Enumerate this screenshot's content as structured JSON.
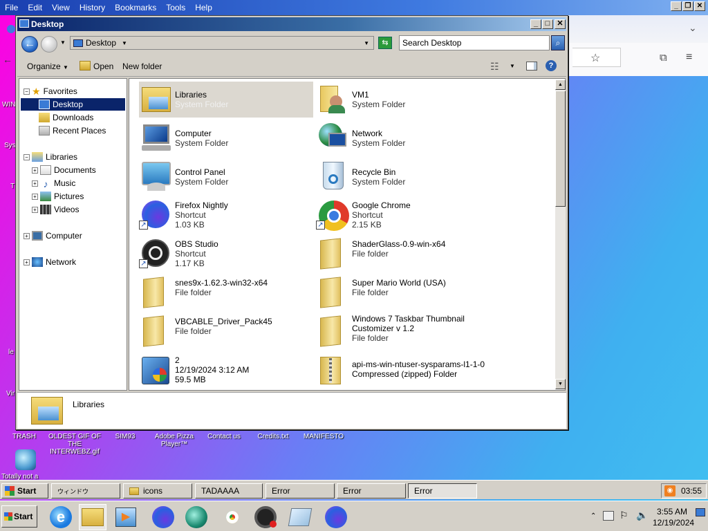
{
  "menubar": {
    "items": [
      "File",
      "Edit",
      "View",
      "History",
      "Bookmarks",
      "Tools",
      "Help"
    ]
  },
  "desktop": {
    "icons": [
      "TRASH",
      "OLDEST GIF OF THE INTERWEBZ.gif",
      "SIM93",
      "Adobe Pizza Player™",
      "Contact us",
      "Credits.txt",
      "MANIFESTO"
    ],
    "shortcut_label": "Totally not a",
    "edge_labels": [
      "WIN",
      "Sys",
      "T",
      "le",
      "Vir"
    ]
  },
  "window": {
    "title": "Desktop",
    "address": "Desktop",
    "search_placeholder": "Search Desktop",
    "toolbar": {
      "organize": "Organize",
      "open": "Open",
      "new_folder": "New folder"
    }
  },
  "nav": {
    "favorites": "Favorites",
    "fav_items": [
      "Desktop",
      "Downloads",
      "Recent Places"
    ],
    "libraries": "Libraries",
    "lib_items": [
      "Documents",
      "Music",
      "Pictures",
      "Videos"
    ],
    "computer": "Computer",
    "network": "Network"
  },
  "items": [
    {
      "name": "Libraries",
      "l1": "System Folder",
      "l2": ""
    },
    {
      "name": "VM1",
      "l1": "System Folder",
      "l2": ""
    },
    {
      "name": "Computer",
      "l1": "System Folder",
      "l2": ""
    },
    {
      "name": "Network",
      "l1": "System Folder",
      "l2": ""
    },
    {
      "name": "Control Panel",
      "l1": "System Folder",
      "l2": ""
    },
    {
      "name": "Recycle Bin",
      "l1": "System Folder",
      "l2": ""
    },
    {
      "name": "Firefox Nightly",
      "l1": "Shortcut",
      "l2": "1.03 KB"
    },
    {
      "name": "Google Chrome",
      "l1": "Shortcut",
      "l2": "2.15 KB"
    },
    {
      "name": "OBS Studio",
      "l1": "Shortcut",
      "l2": "1.17 KB"
    },
    {
      "name": "ShaderGlass-0.9-win-x64",
      "l1": "File folder",
      "l2": ""
    },
    {
      "name": "snes9x-1.62.3-win32-x64",
      "l1": "File folder",
      "l2": ""
    },
    {
      "name": "Super Mario World (USA)",
      "l1": "File folder",
      "l2": ""
    },
    {
      "name": "VBCABLE_Driver_Pack45",
      "l1": "File folder",
      "l2": ""
    },
    {
      "name": "Windows 7 Taskbar Thumbnail",
      "l1": "Customizer v 1.2",
      "l2": "File folder"
    },
    {
      "name": "2",
      "l1": "12/19/2024 3:12 AM",
      "l2": "59.5 MB"
    },
    {
      "name": "api-ms-win-ntuser-sysparams-l1-1-0",
      "l1": "Compressed (zipped) Folder",
      "l2": ""
    }
  ],
  "details": {
    "name": "Libraries"
  },
  "taskbar1": {
    "start": "Start",
    "buttons": [
      "ウィンドウ",
      "icons",
      "TADAAAA",
      "Error",
      "Error",
      "Error"
    ],
    "clock": "03:55"
  },
  "taskbar2": {
    "start": "Start",
    "time": "3:55 AM",
    "date": "12/19/2024"
  },
  "colors": {
    "title_start": "#0a246a",
    "title_end": "#a6caf0",
    "face": "#d4d0c8",
    "selection": "#dcd8d0"
  }
}
